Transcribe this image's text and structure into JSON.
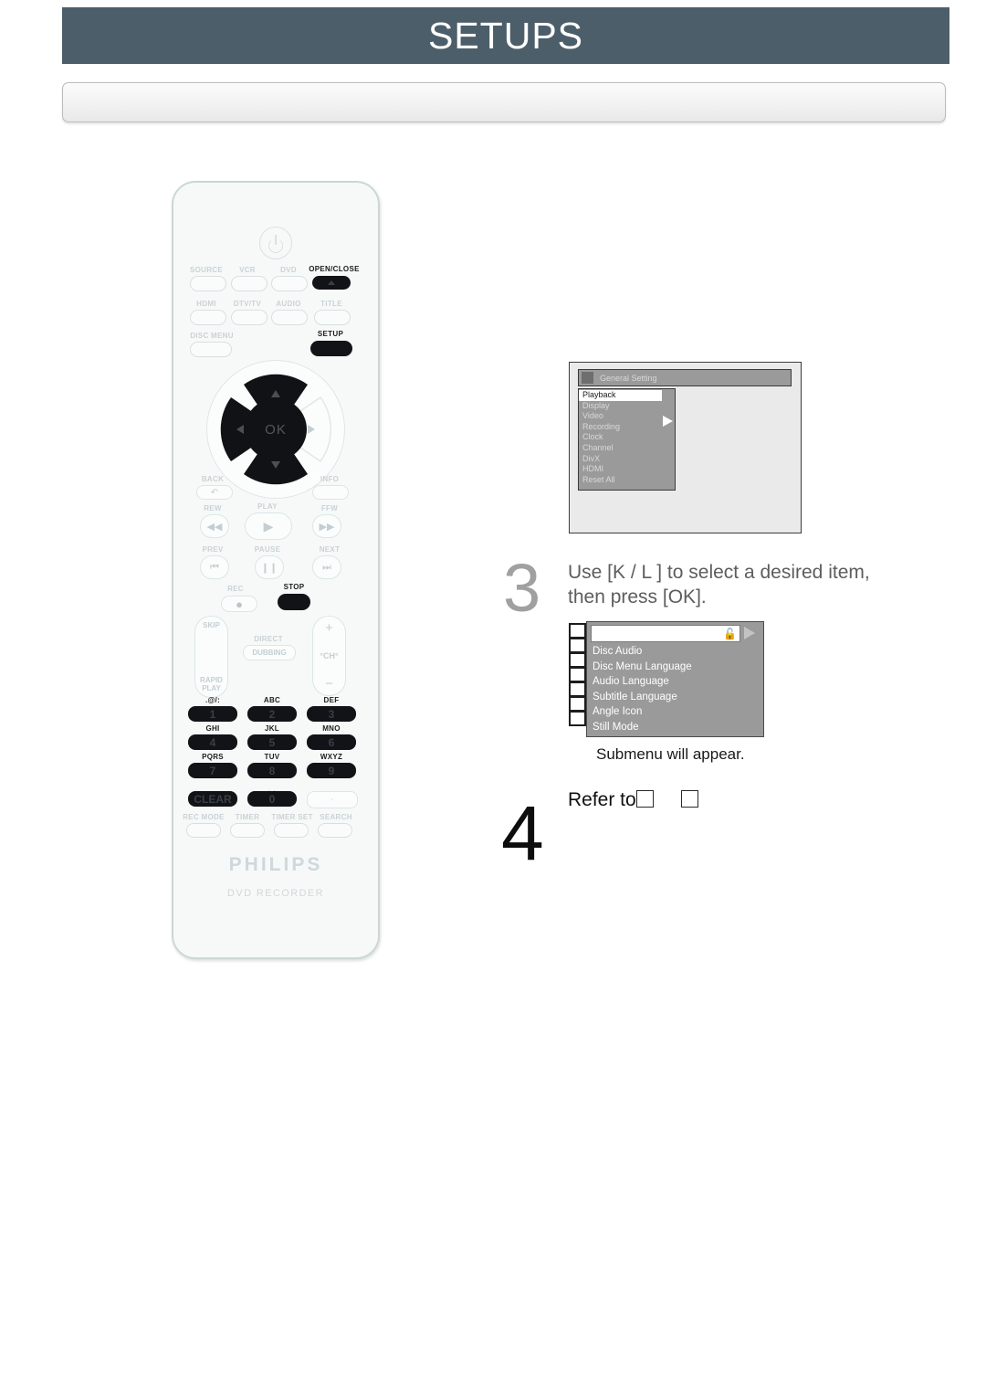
{
  "header": {
    "title": "SETUPS"
  },
  "remote": {
    "brand": "PHILIPS",
    "product": "DVD RECORDER",
    "power_icon": "power-icon",
    "rows": [
      {
        "labels": [
          "SOURCE",
          "VCR",
          "DVD",
          "OPEN/CLOSE"
        ]
      },
      {
        "labels": [
          "HDMI",
          "DTV/TV",
          "AUDIO",
          "TITLE"
        ]
      },
      {
        "labels": [
          "DISC MENU",
          "SETUP"
        ]
      }
    ],
    "ok_label": "OK",
    "nav_labels": [
      "BACK",
      "INFO"
    ],
    "transport_row1": [
      "REW",
      "PLAY",
      "FFW"
    ],
    "transport_row2": [
      "PREV",
      "PAUSE",
      "NEXT"
    ],
    "transport_row3": [
      "REC",
      "STOP"
    ],
    "side_left": [
      "SKIP",
      "RAPID",
      "PLAY"
    ],
    "dubbing": {
      "top_label": "DIRECT",
      "label": "DUBBING"
    },
    "channel": {
      "plus": "+",
      "label": "°CH°",
      "minus": "−"
    },
    "keypad": [
      {
        "letters": ".@/:",
        "digit": "1"
      },
      {
        "letters": "ABC",
        "digit": "2"
      },
      {
        "letters": "DEF",
        "digit": "3"
      },
      {
        "letters": "GHI",
        "digit": "4"
      },
      {
        "letters": "JKL",
        "digit": "5"
      },
      {
        "letters": "MNO",
        "digit": "6"
      },
      {
        "letters": "PQRS",
        "digit": "7"
      },
      {
        "letters": "TUV",
        "digit": "8"
      },
      {
        "letters": "WXYZ",
        "digit": "9"
      }
    ],
    "bottom_keys": {
      "clear": "CLEAR",
      "zero": "0",
      "dot": "·"
    },
    "bottom_labels": [
      "REC MODE",
      "TIMER",
      "TIMER SET",
      "SEARCH"
    ]
  },
  "screen_general": {
    "title": "General Setting",
    "items": [
      "Playback",
      "Display",
      "Video",
      "Recording",
      "Clock",
      "Channel",
      "DivX",
      "HDMI",
      "Reset All"
    ],
    "selected_index": 0
  },
  "screen_submenu": {
    "selected_row": "",
    "lock_icon": "lock-icon",
    "items": [
      "Disc Audio",
      "Disc Menu Language",
      "Audio Language",
      "Subtitle Language",
      "Angle Icon",
      "Still Mode"
    ]
  },
  "steps": [
    {
      "number": "3",
      "line1": "Use [K / L ] to select a desired item,",
      "line2": "then press [OK]."
    },
    {
      "number": "4",
      "line1": "Refer to"
    }
  ],
  "caption": "Submenu will appear."
}
